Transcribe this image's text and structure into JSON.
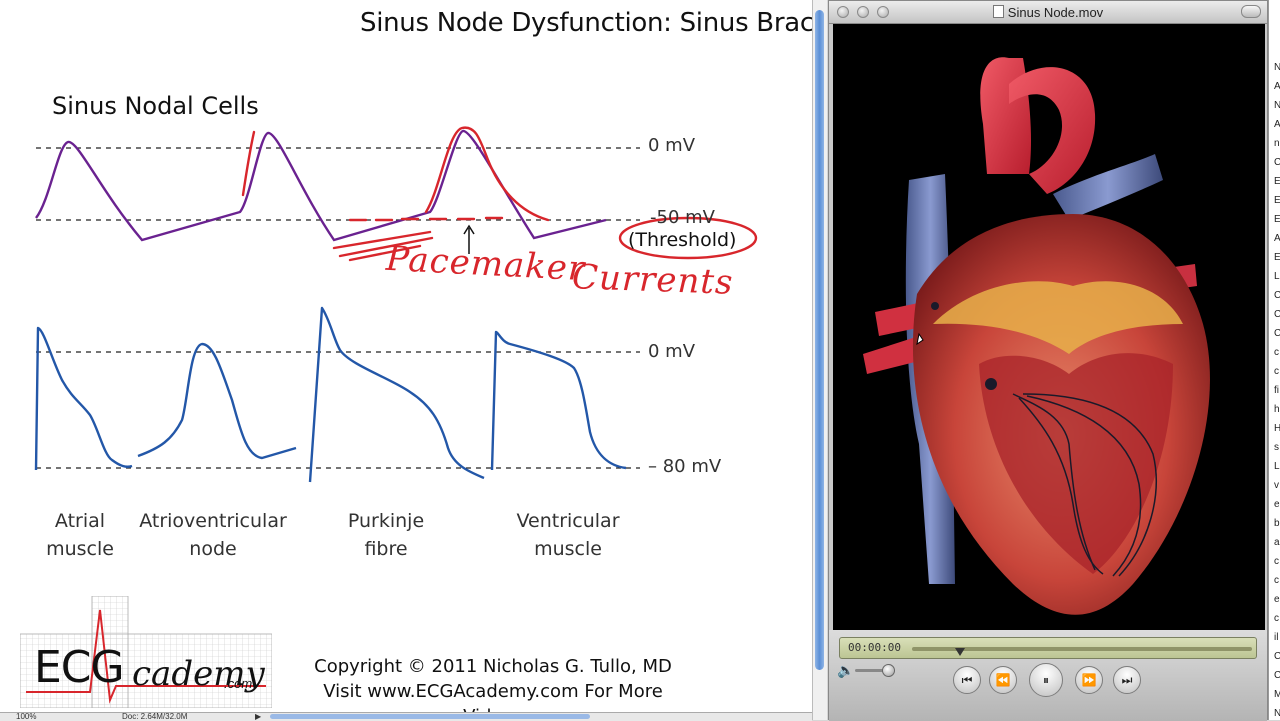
{
  "slide": {
    "title": "Sinus Node Dysfunction:  Sinus Brac",
    "section_title": "Sinus Nodal Cells",
    "labels": {
      "zero_mv_top": "0 mV",
      "fifty_mv": "-50 mV",
      "threshold": "(Threshold)",
      "zero_mv_bottom": "0 mV",
      "eighty_mv": "– 80 mV"
    },
    "handwritten": {
      "pacemaker": "Pacemaker",
      "currents": "Currents"
    },
    "cells": [
      {
        "line1": "Atrial",
        "line2": "muscle"
      },
      {
        "line1": "Atrioventricular",
        "line2": "node"
      },
      {
        "line1": "Purkinje",
        "line2": "fibre"
      },
      {
        "line1": "Ventricular",
        "line2": "muscle"
      }
    ],
    "logo": {
      "text": "ECG",
      "text2": "cademy",
      "suffix": ".com"
    },
    "copyright_line1": "Copyright © 2011 Nicholas G. Tullo, MD",
    "copyright_line2": "Visit www.ECGAcademy.com For More Videos",
    "colors": {
      "purple": "#6a2290",
      "blue": "#2357a8",
      "annotation_red": "#d8262c"
    }
  },
  "statusbar": {
    "zoom": "100%",
    "doc": "Doc: 2.64M/32.0M"
  },
  "player": {
    "window_title": "Sinus Node.mov",
    "time": "00:00:00",
    "progress": 0.14,
    "volume": 0.8
  },
  "sidestrip_letters": [
    "N",
    "A",
    "N",
    "A",
    "n",
    "C",
    "E",
    "E",
    "E",
    "A",
    "E",
    "L",
    "C",
    "C",
    "C",
    "c",
    "c",
    "fi",
    "h",
    "H",
    "s",
    "L",
    "v",
    "e",
    "b",
    "a",
    "c",
    "c",
    "e",
    "c",
    "il",
    "C",
    "C",
    "M",
    "N",
    "R"
  ]
}
